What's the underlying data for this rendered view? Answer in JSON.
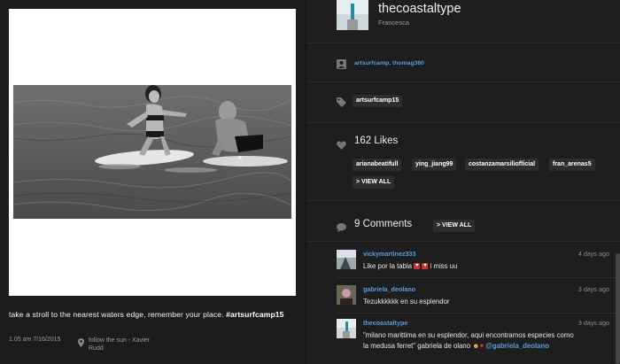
{
  "post": {
    "caption_text": "take a stroll to the nearest waters edge, remember your place. ",
    "caption_tag": "#artsurfcamp15",
    "timestamp": "1.05 am 7/16/2015",
    "location_line1": "follow the sun - Xavier",
    "location_line2": "Rudd"
  },
  "profile": {
    "username": "thecoastaltype",
    "display_name": "Francesca"
  },
  "tagged_users": "artsurfcamp, thomag360",
  "hashtag": "artsurfcamp15",
  "likes": {
    "label": "162 Likes",
    "users": [
      "arianabeatifull",
      "ying_jiang99",
      "costanzamarsiliofficial",
      "fran_arenas5"
    ],
    "view_all": "> VIEW ALL"
  },
  "comments": {
    "label": "9 Comments",
    "view_all": "> VIEW ALL",
    "items": [
      {
        "user": "vickymartinez333",
        "time": "4 days ago",
        "text_a": "Like por la tabla ",
        "text_b": " i miss uu"
      },
      {
        "user": "gabriela_deolano",
        "time": "3 days ago",
        "text": "Tezukkkkkk en su esplendor"
      },
      {
        "user": "thecoastaltype",
        "time": "3 days ago",
        "line1": "\"milano marittima en su esplendor, aqui encontramos especies como",
        "line2": "la medusa ferret\" gabriela de olano ",
        "mention": "@gabriela_deolano"
      }
    ]
  },
  "colors": {
    "link": "#5b9bd5",
    "background": "#1e1e1e",
    "pill": "#2d2d2d"
  }
}
